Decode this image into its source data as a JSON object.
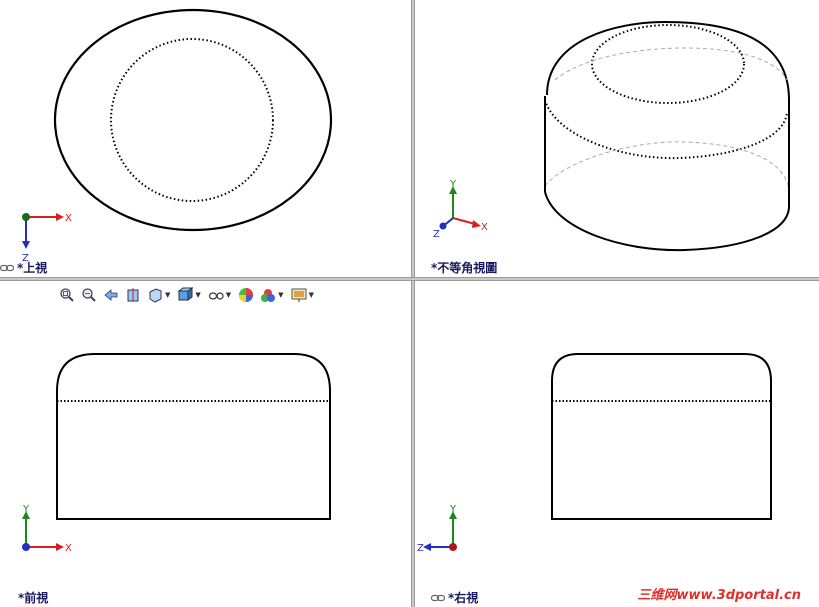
{
  "viewports": {
    "top": {
      "label": "*上視"
    },
    "isometric": {
      "label": "*不等角視圖"
    },
    "front": {
      "label": "*前視"
    },
    "right": {
      "label": "*右視"
    }
  },
  "axes": {
    "x": "X",
    "y": "Y",
    "z": "Z"
  },
  "toolbar": {
    "buttons": [
      {
        "icon": "zoom-to-fit-icon"
      },
      {
        "icon": "zoom-to-area-icon"
      },
      {
        "icon": "previous-view-icon"
      },
      {
        "icon": "section-view-icon"
      },
      {
        "icon": "view-orientation-icon"
      },
      {
        "icon": "display-style-icon"
      },
      {
        "icon": "hide-show-items-icon"
      },
      {
        "icon": "edit-appearance-icon"
      },
      {
        "icon": "apply-scene-icon"
      },
      {
        "icon": "view-settings-icon"
      }
    ]
  },
  "watermark": "三维网www.3dportal.cn",
  "colors": {
    "x_axis": "#d42020",
    "y_axis": "#1a8a1a",
    "z_axis": "#2030c0",
    "label": "#1a1a60"
  }
}
